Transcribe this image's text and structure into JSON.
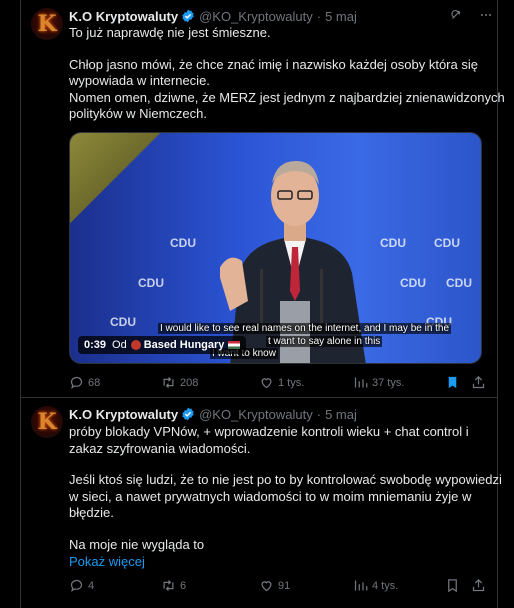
{
  "tweets": [
    {
      "author": {
        "name": "K.O Kryptowaluty",
        "handle": "@KO_Kryptowaluty",
        "dot": "·",
        "date": "5 maj"
      },
      "text": [
        "To już naprawdę nie jest śmieszne.",
        "",
        "Chłop jasno mówi, że chce znać imię i nazwisko każdej osoby która się",
        "wypowiada w internecie.",
        "Nomen omen, dziwne, że MERZ jest jednym z najbardziej znienawidzonych",
        "polityków w Niemczech."
      ],
      "video": {
        "subtitle_line1": "I would like to see real names on the internet, and I may be in the",
        "subtitle_line2": "t want to say alone in this",
        "subtitle_line3": "I want to know",
        "duration": "0:39",
        "from_label": "Od",
        "source": "Based Hungary",
        "cdu_label": "CDU"
      },
      "stats": {
        "replies": "68",
        "reposts": "208",
        "likes": "1 tys.",
        "views": "37 tys."
      }
    },
    {
      "author": {
        "name": "K.O Kryptowaluty",
        "handle": "@KO_Kryptowaluty",
        "dot": "·",
        "date": "5 maj"
      },
      "text": [
        "próby blokady VPNów,  + wprowadzenie kontroli wieku + chat control i",
        "zakaz szyfrowania wiadomości.",
        "",
        "Jeśli ktoś się ludzi, że to nie jest po to by kontrolować swobodę wypowiedzi",
        "w sieci, a nawet prywatnych wiadomości to w moim mniemaniu żyje w",
        "błędzie.",
        "",
        "Na moje nie wygląda to"
      ],
      "show_more": "Pokaż więcej",
      "stats": {
        "replies": "4",
        "reposts": "6",
        "likes": "91",
        "views": "4 tys."
      }
    }
  ],
  "colors": {
    "accent": "#1d9bf0",
    "muted": "#71767b",
    "bookmark_active": "#1d9bf0"
  },
  "icons": [
    "grok-icon",
    "more-icon",
    "reply-icon",
    "repost-icon",
    "like-icon",
    "views-icon",
    "bookmark-icon",
    "share-icon",
    "verified-icon"
  ]
}
